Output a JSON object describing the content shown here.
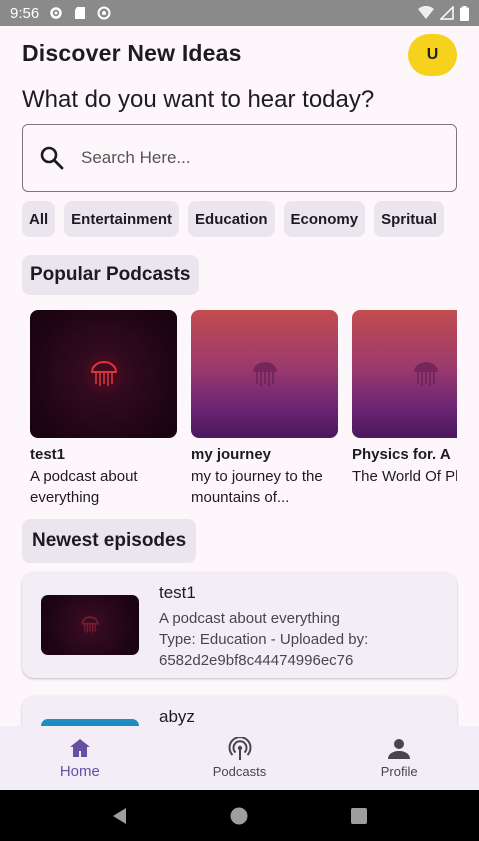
{
  "status_bar": {
    "time": "9:56"
  },
  "header": {
    "title": "Discover New Ideas",
    "avatar_initial": "U"
  },
  "subtitle": "What do you want to hear today?",
  "search": {
    "placeholder": "Search Here...",
    "value": ""
  },
  "categories": [
    "All",
    "Entertainment",
    "Education",
    "Economy",
    "Spritual"
  ],
  "popular": {
    "label": "Popular Podcasts",
    "items": [
      {
        "title": "test1",
        "description": "A podcast about everything",
        "icon": "jellyfish-icon"
      },
      {
        "title": "my journey",
        "description": "my to journey to the mountains of...",
        "icon": "jellyfish-icon"
      },
      {
        "title": "Physics for. A",
        "description": "The World Of Physics",
        "icon": "jellyfish-icon"
      }
    ]
  },
  "newest": {
    "label": "Newest episodes",
    "items": [
      {
        "title": "test1",
        "description": "A podcast about everything",
        "meta": "Type: Education - Uploaded by:",
        "uploader": "6582d2e9bf8c44474996ec76"
      },
      {
        "title": "abyz"
      }
    ]
  },
  "bottom_nav": [
    {
      "label": "Home",
      "icon": "home-icon",
      "active": true
    },
    {
      "label": "Podcasts",
      "icon": "podcast-icon",
      "active": false
    },
    {
      "label": "Profile",
      "icon": "person-icon",
      "active": false
    }
  ],
  "colors": {
    "accent": "#6750a4",
    "avatar": "#f7d21c",
    "background": "#fdf7fc"
  }
}
